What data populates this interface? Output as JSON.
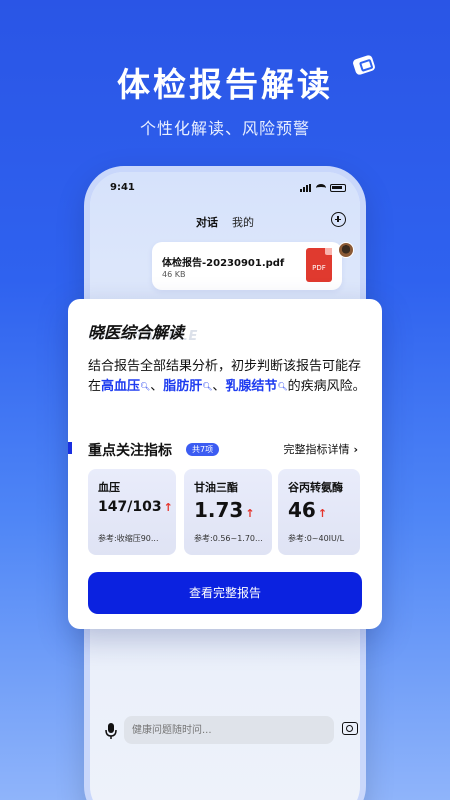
{
  "hero": {
    "title": "体检报告解读",
    "subtitle": "个性化解读、风险预警"
  },
  "phone": {
    "status_time": "9:41",
    "tabs": [
      "对话",
      "我的"
    ],
    "file": {
      "name": "体检报告-20230901.pdf",
      "size": "46 KB",
      "icon_label": "PDF"
    },
    "input_placeholder": "健康问题随时问..."
  },
  "card": {
    "title": "晓医综合解读",
    "watermark": "UNSCRAMBLE",
    "desc_prefix": "结合报告全部结果分析，初步判断该报告可能存在",
    "conditions": [
      "高血压",
      "脂肪肝",
      "乳腺结节"
    ],
    "separator": "、",
    "desc_suffix": "的疾病风险。",
    "section_title": "重点关注指标",
    "count_badge": "共7项",
    "details_link": "完整指标详情",
    "metrics": [
      {
        "name": "血压",
        "value": "147/103",
        "ref": "参考:收缩压90..."
      },
      {
        "name": "甘油三酯",
        "value": "1.73",
        "ref": "参考:0.56~1.70..."
      },
      {
        "name": "谷丙转氨酶",
        "value": "46",
        "ref": "参考:0~40IU/L"
      }
    ],
    "report_button": "查看完整报告"
  },
  "colors": {
    "primary": "#0b22e0",
    "highlight": "#1e3cf0",
    "alert": "#e5352c"
  }
}
